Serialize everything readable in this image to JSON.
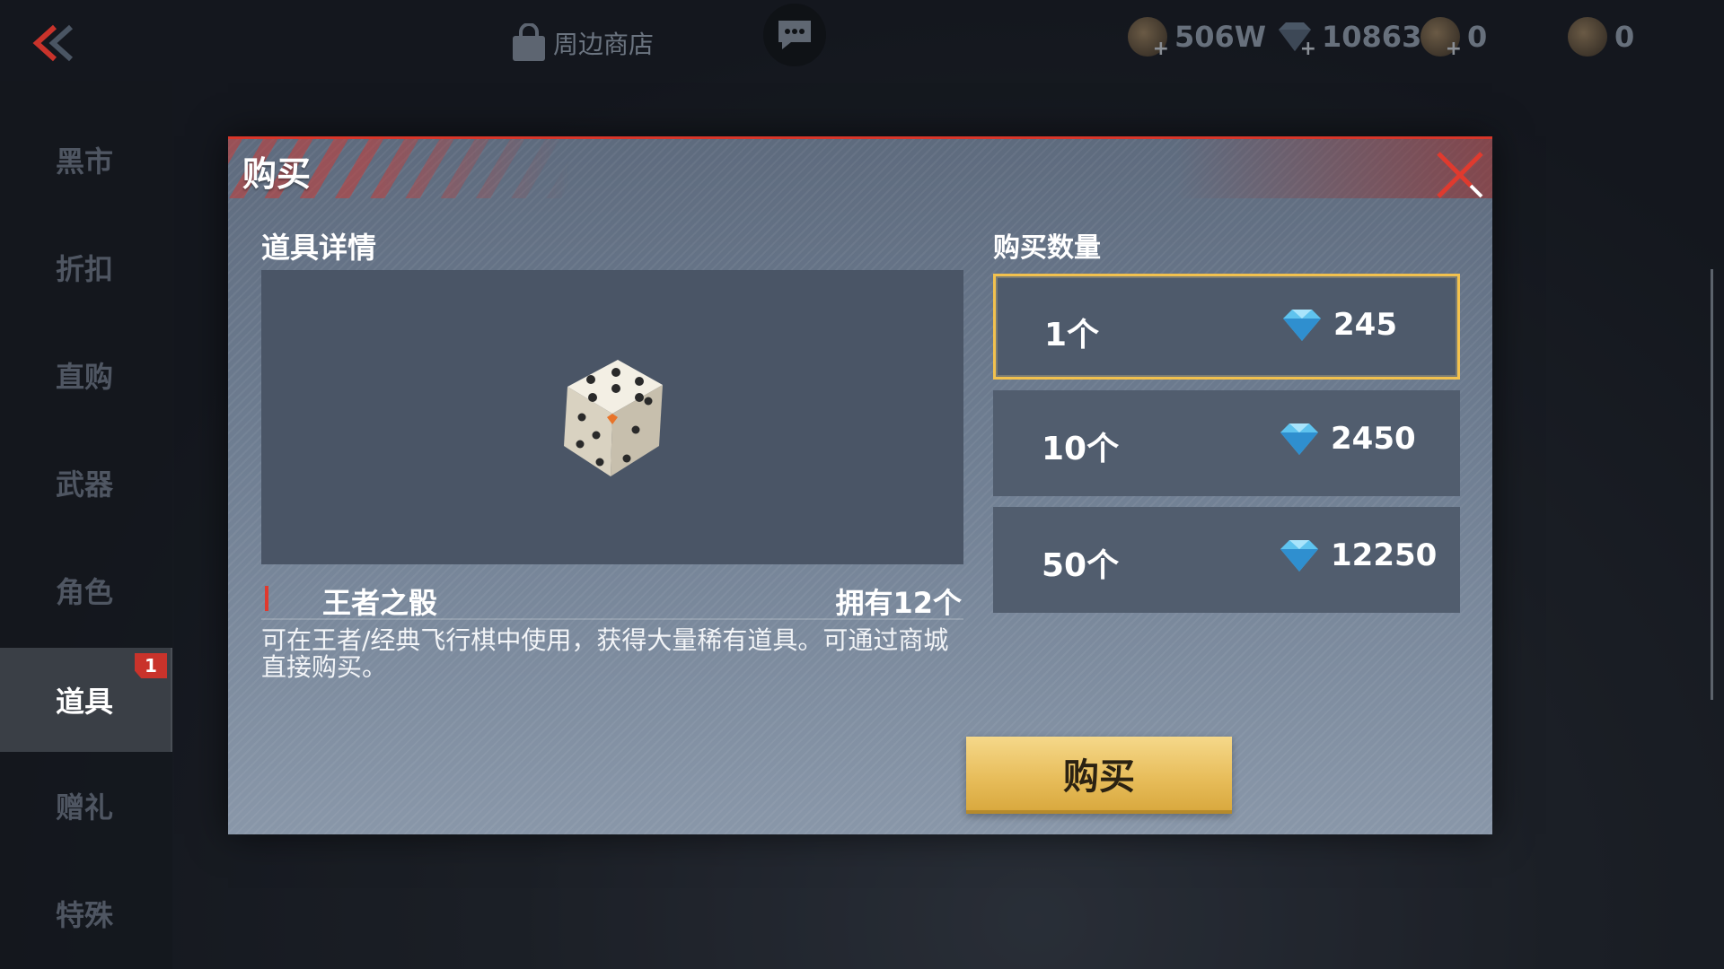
{
  "topbar": {
    "shop_label": "周边商店",
    "currencies": [
      {
        "icon": "gold-coin-icon",
        "value": "506W"
      },
      {
        "icon": "diamond-icon",
        "value": "10863"
      },
      {
        "icon": "cf-point-icon",
        "value": "0"
      },
      {
        "icon": "cf-coin-icon",
        "value": "0"
      }
    ]
  },
  "sidebar": {
    "items": [
      {
        "label": "黑市"
      },
      {
        "label": "折扣"
      },
      {
        "label": "直购"
      },
      {
        "label": "武器"
      },
      {
        "label": "角色"
      },
      {
        "label": "道具",
        "active": true,
        "badge": "1"
      },
      {
        "label": "赠礼"
      },
      {
        "label": "特殊"
      }
    ]
  },
  "modal": {
    "title": "购买",
    "details_label": "道具详情",
    "quantity_label": "购买数量",
    "item": {
      "icon": "dice-icon",
      "name": "王者之骰",
      "owned": "拥有12个",
      "description": "可在王者/经典飞行棋中使用，获得大量稀有道具。可通过商城直接购买。"
    },
    "options": [
      {
        "qty": "1个",
        "price": "245",
        "selected": true
      },
      {
        "qty": "10个",
        "price": "2450"
      },
      {
        "qty": "50个",
        "price": "12250"
      }
    ],
    "buy_label": "购买"
  },
  "colors": {
    "accent_red": "#d8362a",
    "selected_gold": "#f2c14e",
    "buy_button": "#e8be5c"
  }
}
